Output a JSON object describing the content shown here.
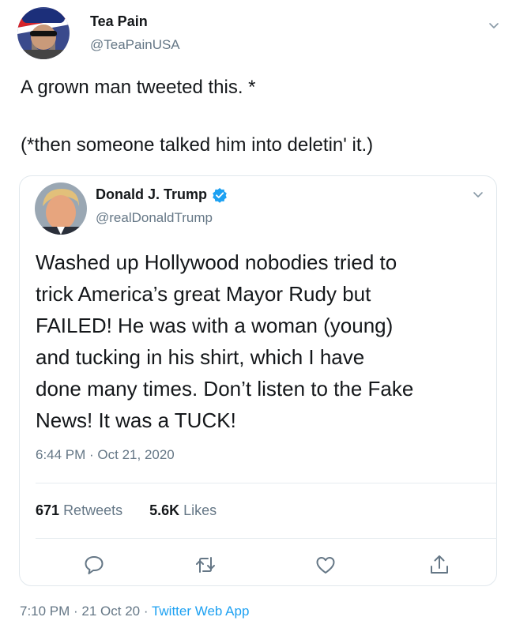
{
  "outer_tweet": {
    "display_name": "Tea Pain",
    "handle": "@TeaPainUSA",
    "text_line_1": "A grown man tweeted this. *",
    "text_line_2": "(*then someone talked him into deletin' it.)",
    "timestamp": "7:10 PM · 21 Oct 20",
    "separator": " · ",
    "source": "Twitter Web App"
  },
  "quoted_tweet": {
    "display_name": "Donald J. Trump",
    "handle": "@realDonaldTrump",
    "verified": true,
    "body_lines": [
      "Washed up Hollywood nobodies tried to",
      "trick America’s great Mayor Rudy but",
      "FAILED! He was with a woman (young)",
      "and tucking in his shirt, which I have",
      "done many times. Don’t listen to the Fake",
      "News! It was a TUCK!"
    ],
    "timestamp": "6:44 PM · Oct 21, 2020",
    "retweets_count": "671",
    "retweets_label": "Retweets",
    "likes_count": "5.6K",
    "likes_label": "Likes"
  },
  "icons": {
    "caret": "chevron-down-icon",
    "verified": "verified-badge-icon",
    "reply": "reply-icon",
    "retweet": "retweet-icon",
    "like": "heart-icon",
    "share": "share-icon"
  },
  "colors": {
    "text_primary": "#14171a",
    "text_secondary": "#657786",
    "accent": "#1da1f2",
    "border": "#e1e8ed"
  }
}
